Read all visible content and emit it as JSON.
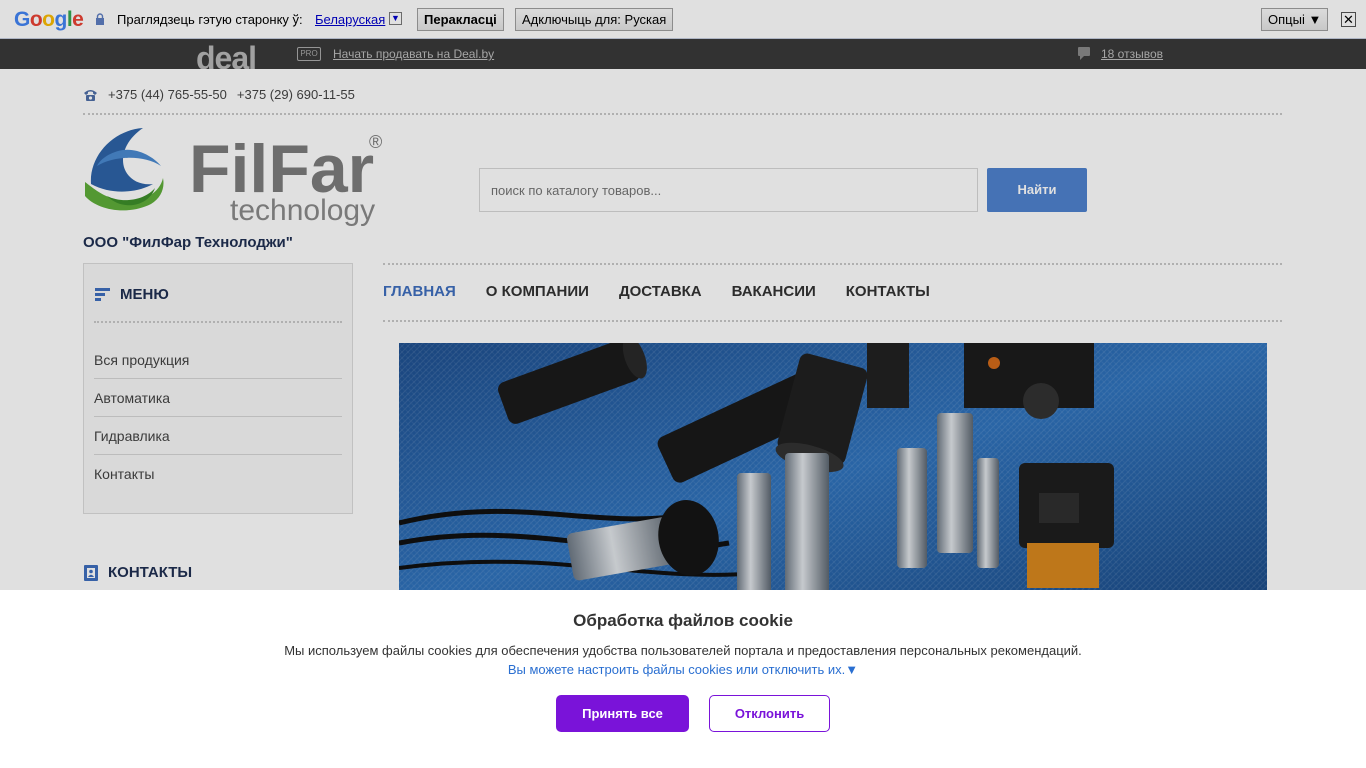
{
  "translate_bar": {
    "logo": "Google",
    "prompt": "Праглядзець гэтую старонку ў:",
    "language": "Беларуская",
    "translate_button": "Перакласці",
    "disable_button": "Адключыць для: Руская",
    "options_button": "Опцыі ▼",
    "close_glyph": "✕"
  },
  "deal_bar": {
    "logo": "deal",
    "pro_badge": "PRO",
    "sell_link": "Начать продавать на Deal.by",
    "reviews_link": "18 отзывов"
  },
  "header": {
    "phones": [
      "+375 (44) 765-55-50",
      "+375 (29) 690-11-55"
    ],
    "logo_main": "FilFar",
    "logo_sub": "technology",
    "logo_reg": "®",
    "company_name": "ООО \"ФилФар Технолоджи\"",
    "search_placeholder": "поиск по каталогу товаров...",
    "search_button": "Найти"
  },
  "sidebar": {
    "menu_title": "МЕНЮ",
    "items": [
      {
        "label": "Вся продукция"
      },
      {
        "label": "Автоматика"
      },
      {
        "label": "Гидравлика"
      },
      {
        "label": "Контакты"
      }
    ],
    "contacts_title": "КОНТАКТЫ"
  },
  "nav": {
    "items": [
      {
        "label": "ГЛАВНАЯ",
        "active": true
      },
      {
        "label": "О КОМПАНИИ"
      },
      {
        "label": "ДОСТАВКА"
      },
      {
        "label": "ВАКАНСИИ"
      },
      {
        "label": "КОНТАКТЫ"
      }
    ]
  },
  "cookie": {
    "title": "Обработка файлов cookie",
    "text": "Мы используем файлы cookies для обеспечения удобства пользователей портала и предоставления персональных рекомендаций.",
    "settings_link": "Вы можете настроить файлы cookies или отключить их.▼",
    "accept_button": "Принять все",
    "decline_button": "Отклонить"
  },
  "colors": {
    "accent": "#4f82cf",
    "cookie_accent": "#7a13d9",
    "navy": "#1f2f52"
  }
}
